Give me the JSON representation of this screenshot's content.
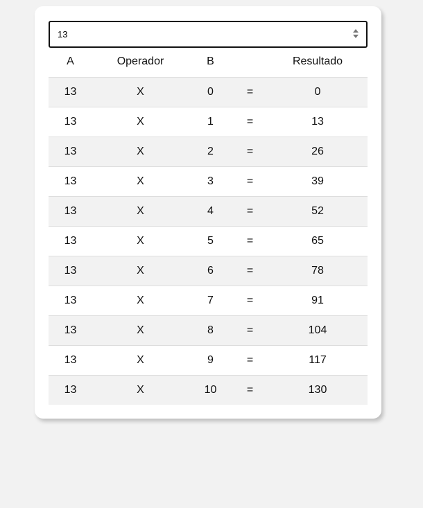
{
  "input": {
    "value": "13"
  },
  "table": {
    "headers": {
      "a": "A",
      "operator": "Operador",
      "b": "B",
      "equals": "",
      "result": "Resultado"
    },
    "rows": [
      {
        "a": "13",
        "op": "X",
        "b": "0",
        "eq": "=",
        "result": "0"
      },
      {
        "a": "13",
        "op": "X",
        "b": "1",
        "eq": "=",
        "result": "13"
      },
      {
        "a": "13",
        "op": "X",
        "b": "2",
        "eq": "=",
        "result": "26"
      },
      {
        "a": "13",
        "op": "X",
        "b": "3",
        "eq": "=",
        "result": "39"
      },
      {
        "a": "13",
        "op": "X",
        "b": "4",
        "eq": "=",
        "result": "52"
      },
      {
        "a": "13",
        "op": "X",
        "b": "5",
        "eq": "=",
        "result": "65"
      },
      {
        "a": "13",
        "op": "X",
        "b": "6",
        "eq": "=",
        "result": "78"
      },
      {
        "a": "13",
        "op": "X",
        "b": "7",
        "eq": "=",
        "result": "91"
      },
      {
        "a": "13",
        "op": "X",
        "b": "8",
        "eq": "=",
        "result": "104"
      },
      {
        "a": "13",
        "op": "X",
        "b": "9",
        "eq": "=",
        "result": "117"
      },
      {
        "a": "13",
        "op": "X",
        "b": "10",
        "eq": "=",
        "result": "130"
      }
    ]
  },
  "colors": {
    "page_background": "#f2f2f2",
    "card_background": "#ffffff",
    "striped_row": "#f2f2f2",
    "input_border": "#111111"
  },
  "icons": {
    "spinner": "number-spinner-icon"
  }
}
